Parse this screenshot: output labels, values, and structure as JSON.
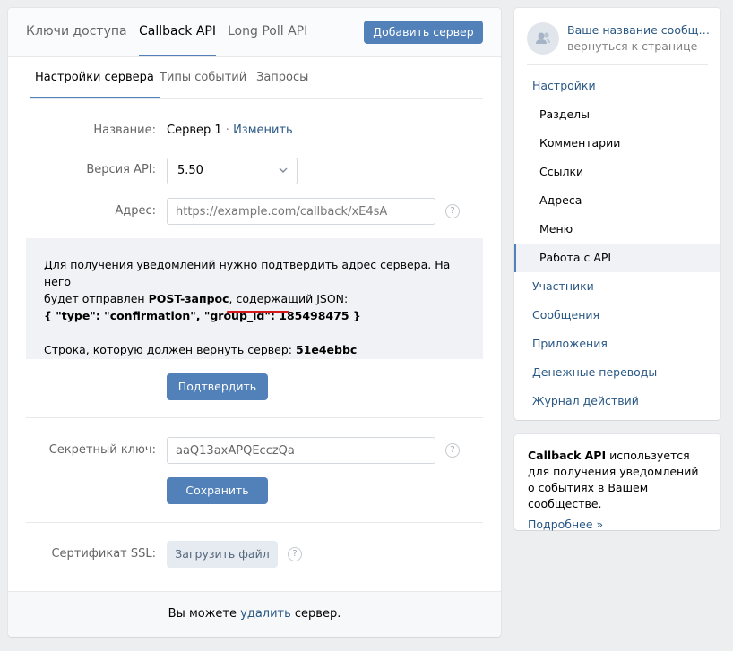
{
  "top_tabs": [
    "Ключи доступа",
    "Callback API",
    "Long Poll API"
  ],
  "add_server_button": "Добавить сервер",
  "sub_tabs": [
    "Настройки сервера",
    "Типы событий",
    "Запросы"
  ],
  "form": {
    "name_label": "Название:",
    "name_value": "Сервер 1",
    "name_separator": " · ",
    "name_edit": "Изменить",
    "api_version_label": "Версия API:",
    "api_version_value": "5.50",
    "address_label": "Адрес:",
    "address_placeholder": "https://example.com/callback/xE4sA",
    "help_glyph": "?"
  },
  "info": {
    "line1": "Для получения уведомлений нужно подтвердить адрес сервера. На него",
    "line2_prefix": "будет отправлен ",
    "line2_bold": "POST-запрос",
    "line2_suffix": ", содержащий JSON:",
    "json_prefix": "{ \"type\": \"confirmation\", \"group_id\": ",
    "group_id": "185498475",
    "json_suffix": " }",
    "return_label": "Строка, которую должен вернуть сервер: ",
    "return_code": "51e4ebbc"
  },
  "confirm_button": "Подтвердить",
  "secret": {
    "label": "Секретный ключ:",
    "value": "aaQ13axAPQEcczQa",
    "save_button": "Сохранить"
  },
  "ssl": {
    "label": "Сертификат SSL:",
    "upload_button": "Загрузить файл"
  },
  "footer": {
    "prefix": "Вы можете ",
    "link": "удалить",
    "suffix": " сервер."
  },
  "sidebar": {
    "community_name": "Ваше название сообщества",
    "back_link": "вернуться к странице",
    "items": [
      {
        "label": "Настройки",
        "sub": false
      },
      {
        "label": "Разделы",
        "sub": true
      },
      {
        "label": "Комментарии",
        "sub": true
      },
      {
        "label": "Ссылки",
        "sub": true
      },
      {
        "label": "Адреса",
        "sub": true
      },
      {
        "label": "Меню",
        "sub": true
      },
      {
        "label": "Работа с API",
        "sub": true,
        "active": true
      },
      {
        "label": "Участники",
        "sub": false
      },
      {
        "label": "Сообщения",
        "sub": false
      },
      {
        "label": "Приложения",
        "sub": false
      },
      {
        "label": "Денежные переводы",
        "sub": false
      },
      {
        "label": "Журнал действий",
        "sub": false
      }
    ]
  },
  "callback_info": {
    "bold": "Callback API",
    "text": " используется для получения уведомлений о событиях в Вашем сообществе.",
    "more": "Подробнее »"
  },
  "colors": {
    "accent": "#5181b8",
    "link": "#2a5885",
    "highlight_underline": "#d6191b"
  }
}
